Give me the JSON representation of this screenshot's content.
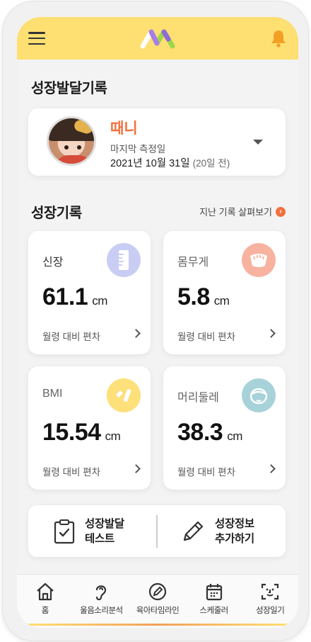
{
  "topbar": {
    "menu_icon": "hamburger-menu-icon",
    "logo": "app-logo",
    "bell_icon": "bell-icon",
    "brand_color": "#fddf72"
  },
  "growth_record_title": "성장발달기록",
  "profile": {
    "name": "때니",
    "last_measured_label": "마지막 측정일",
    "last_measured_date": "2021년 10월 31일",
    "days_ago": "(20일 전)"
  },
  "growth_section": {
    "title": "성장기록",
    "history_link": "지난 기록 살펴보기",
    "history_link_icon": "arrow-right-circle-icon"
  },
  "stats": [
    {
      "label": "신장",
      "value": "61.1",
      "unit": "cm",
      "note": "월령 대비 편차",
      "icon": "ruler-icon",
      "icon_bg": "#c9cdf4"
    },
    {
      "label": "몸무게",
      "value": "5.8",
      "unit": "cm",
      "note": "월령 대비 편차",
      "icon": "scale-icon",
      "icon_bg": "#f7b3a0"
    },
    {
      "label": "BMI",
      "value": "15.54",
      "unit": "cm",
      "note": "월령 대비 편차",
      "icon": "bmi-icon",
      "icon_bg": "#fde07a"
    },
    {
      "label": "머리둘레",
      "value": "38.3",
      "unit": "cm",
      "note": "월령 대비 편차",
      "icon": "head-circumference-icon",
      "icon_bg": "#a8d2d9"
    }
  ],
  "actions": {
    "test_line1": "성장발달",
    "test_line2": "테스트",
    "add_line1": "성장정보",
    "add_line2": "추가하기"
  },
  "nav": [
    {
      "label": "홈",
      "icon": "home-icon"
    },
    {
      "label": "울음소리분석",
      "icon": "ear-icon"
    },
    {
      "label": "육아타임라인",
      "icon": "pencil-circle-icon"
    },
    {
      "label": "스케줄러",
      "icon": "calendar-icon"
    },
    {
      "label": "성장일기",
      "icon": "face-scan-icon"
    }
  ]
}
